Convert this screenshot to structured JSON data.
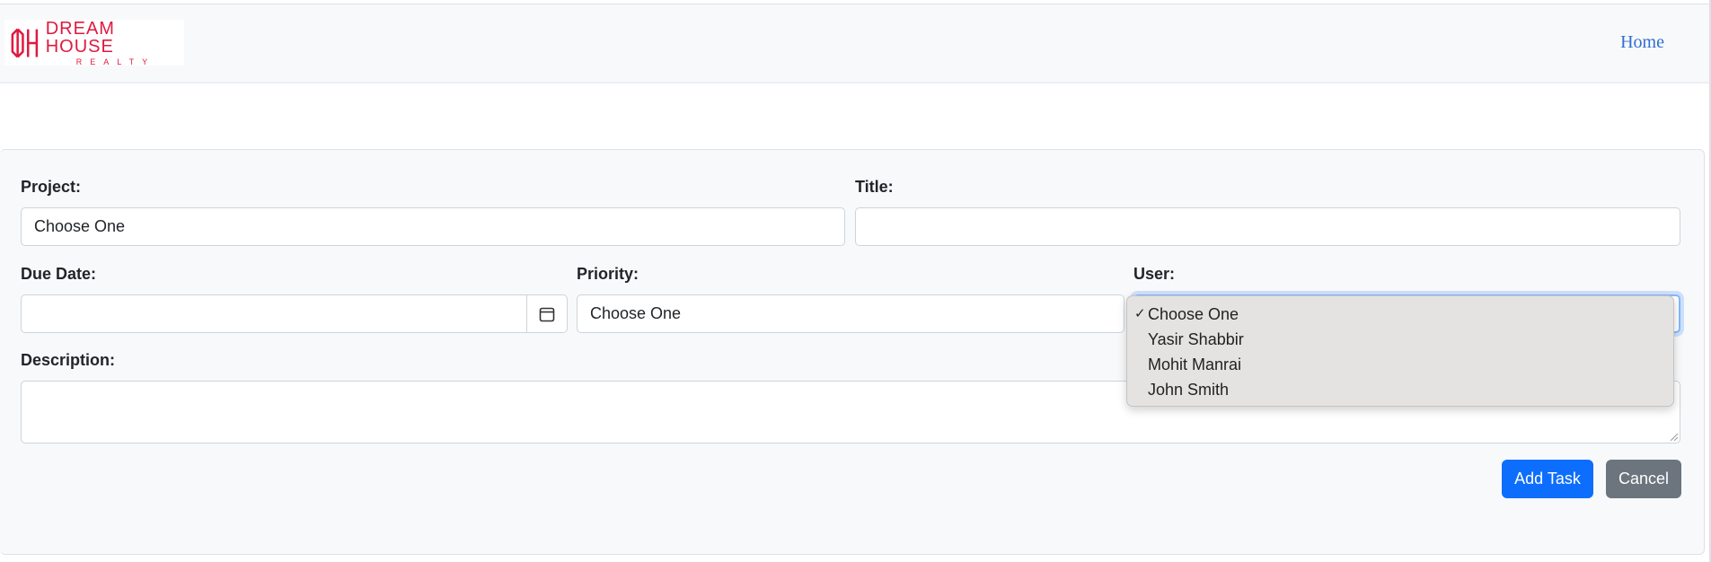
{
  "brand": {
    "logo_line1": "DREAM HOUSE",
    "logo_line2": "REALTY",
    "color": "#e0193f"
  },
  "nav": {
    "home_label": "Home"
  },
  "form": {
    "project": {
      "label": "Project:",
      "value": "Choose One"
    },
    "title": {
      "label": "Title:",
      "value": ""
    },
    "due_date": {
      "label": "Due Date:",
      "value": ""
    },
    "priority": {
      "label": "Priority:",
      "value": "Choose One"
    },
    "user": {
      "label": "User:",
      "value": "Choose One",
      "options": [
        "Choose One",
        "Yasir Shabbir",
        "Mohit Manrai",
        "John Smith"
      ],
      "check_mark": "✓"
    },
    "description": {
      "label": "Description:",
      "value": ""
    }
  },
  "actions": {
    "add_label": "Add Task",
    "cancel_label": "Cancel"
  },
  "colors": {
    "primary": "#0d6efd",
    "secondary": "#6c757d",
    "link": "#2f6fd1"
  }
}
